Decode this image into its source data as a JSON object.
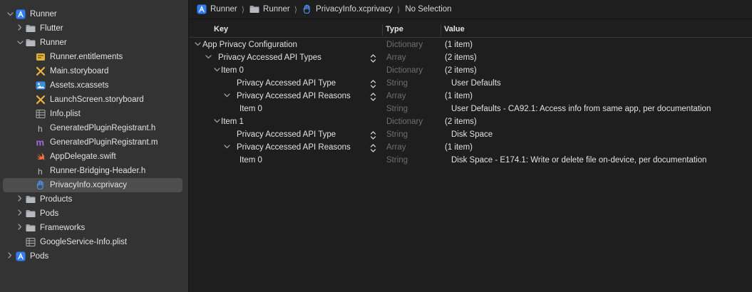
{
  "sidebar": {
    "items": [
      {
        "label": "Runner",
        "icon": "xcode-project-icon",
        "disclosure": "expanded"
      },
      {
        "label": "Flutter",
        "icon": "folder-icon",
        "disclosure": "collapsed"
      },
      {
        "label": "Runner",
        "icon": "folder-icon",
        "disclosure": "expanded"
      },
      {
        "label": "Runner.entitlements",
        "icon": "entitlements-file-icon",
        "disclosure": ""
      },
      {
        "label": "Main.storyboard",
        "icon": "storyboard-file-icon",
        "disclosure": ""
      },
      {
        "label": "Assets.xcassets",
        "icon": "asset-catalog-icon",
        "disclosure": ""
      },
      {
        "label": "LaunchScreen.storyboard",
        "icon": "storyboard-file-icon",
        "disclosure": ""
      },
      {
        "label": "Info.plist",
        "icon": "plist-file-icon",
        "disclosure": ""
      },
      {
        "label": "GeneratedPluginRegistrant.h",
        "icon": "header-file-icon",
        "disclosure": ""
      },
      {
        "label": "GeneratedPluginRegistrant.m",
        "icon": "objc-file-icon",
        "disclosure": ""
      },
      {
        "label": "AppDelegate.swift",
        "icon": "swift-file-icon",
        "disclosure": ""
      },
      {
        "label": "Runner-Bridging-Header.h",
        "icon": "header-file-icon",
        "disclosure": ""
      },
      {
        "label": "PrivacyInfo.xcprivacy",
        "icon": "privacy-hand-icon",
        "disclosure": "",
        "selected": true
      },
      {
        "label": "Products",
        "icon": "folder-icon",
        "disclosure": "collapsed"
      },
      {
        "label": "Pods",
        "icon": "folder-icon",
        "disclosure": "collapsed"
      },
      {
        "label": "Frameworks",
        "icon": "folder-icon",
        "disclosure": "collapsed"
      },
      {
        "label": "GoogleService-Info.plist",
        "icon": "plist-file-icon",
        "disclosure": ""
      },
      {
        "label": "Pods",
        "icon": "xcode-project-icon",
        "disclosure": "collapsed"
      }
    ]
  },
  "jumpbar": {
    "crumbs": [
      {
        "label": "Runner",
        "icon": "xcode-project-icon"
      },
      {
        "label": "Runner",
        "icon": "folder-icon"
      },
      {
        "label": "PrivacyInfo.xcprivacy",
        "icon": "privacy-hand-icon"
      },
      {
        "label": "No Selection",
        "icon": ""
      }
    ]
  },
  "editor": {
    "columns": {
      "key": "Key",
      "type": "Type",
      "value": "Value"
    },
    "rows": [
      {
        "key": "App Privacy Configuration",
        "type": "Dictionary",
        "value": "(1 item)",
        "disclosure": "expanded",
        "stepper": false
      },
      {
        "key": "Privacy Accessed API Types",
        "type": "Array",
        "value": "(2 items)",
        "disclosure": "expanded",
        "stepper": true
      },
      {
        "key": "Item 0",
        "type": "Dictionary",
        "value": "(2 items)",
        "disclosure": "expanded",
        "stepper": false
      },
      {
        "key": "Privacy Accessed API Type",
        "type": "String",
        "value": "User Defaults",
        "disclosure": "",
        "stepper": true
      },
      {
        "key": "Privacy Accessed API Reasons",
        "type": "Array",
        "value": "(1 item)",
        "disclosure": "expanded",
        "stepper": true
      },
      {
        "key": "Item 0",
        "type": "String",
        "value": "User Defaults - CA92.1: Access info from same app, per documentation",
        "disclosure": "",
        "stepper": false
      },
      {
        "key": "Item 1",
        "type": "Dictionary",
        "value": "(2 items)",
        "disclosure": "expanded",
        "stepper": false
      },
      {
        "key": "Privacy Accessed API Type",
        "type": "String",
        "value": "Disk Space",
        "disclosure": "",
        "stepper": true
      },
      {
        "key": "Privacy Accessed API Reasons",
        "type": "Array",
        "value": "(1 item)",
        "disclosure": "expanded",
        "stepper": true
      },
      {
        "key": "Item 0",
        "type": "String",
        "value": "Disk Space - E174.1: Write or delete file on-device, per documentation",
        "disclosure": "",
        "stepper": false
      }
    ]
  }
}
